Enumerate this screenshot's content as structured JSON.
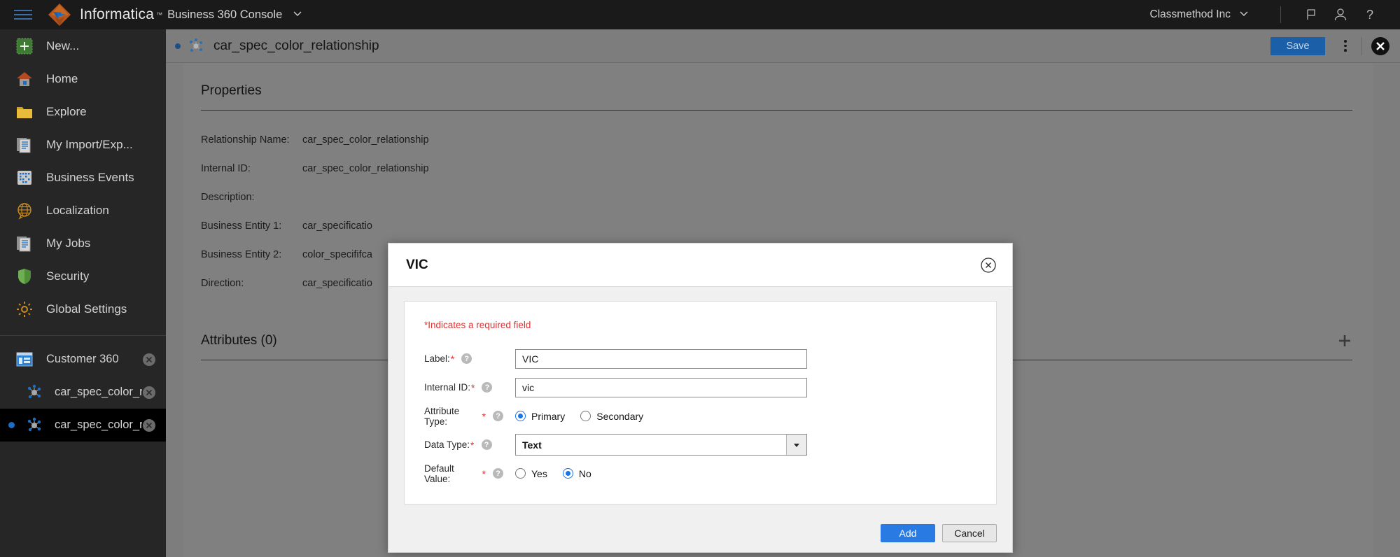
{
  "topbar": {
    "menu_icon": "hamburger-icon",
    "brand": "Informatica",
    "brand_mark": "™",
    "product": "Business 360 Console",
    "product_caret": "chevron-down-icon",
    "org": "Classmethod Inc",
    "org_caret": "chevron-down-icon",
    "flag_icon": "flag-icon",
    "user_icon": "user-icon",
    "help_icon": "help-icon"
  },
  "sidebar": {
    "items": [
      {
        "label": "New...",
        "icon": "plus-square-icon"
      },
      {
        "label": "Home",
        "icon": "home-icon"
      },
      {
        "label": "Explore",
        "icon": "folder-icon"
      },
      {
        "label": "My Import/Exp...",
        "icon": "documents-icon"
      },
      {
        "label": "Business Events",
        "icon": "grid-events-icon"
      },
      {
        "label": "Localization",
        "icon": "globe-icon"
      },
      {
        "label": "My Jobs",
        "icon": "documents-icon"
      },
      {
        "label": "Security",
        "icon": "shield-icon"
      },
      {
        "label": "Global Settings",
        "icon": "gear-icon"
      }
    ],
    "tabs": [
      {
        "label": "Customer 360",
        "icon": "app-window-icon",
        "active": false,
        "close_icon": "close-circle-icon"
      },
      {
        "label": "car_spec_color_r...",
        "icon": "relationship-icon",
        "active": false,
        "close_icon": "close-circle-icon"
      },
      {
        "label": "car_spec_color_r...",
        "icon": "relationship-icon",
        "active": true,
        "close_icon": "close-circle-icon"
      }
    ]
  },
  "document": {
    "title": "car_spec_color_relationship",
    "icon": "relationship-icon",
    "save_label": "Save",
    "kebab_icon": "more-vertical-icon",
    "close_icon": "close-circle-filled-icon"
  },
  "properties": {
    "section_title": "Properties",
    "rows": [
      {
        "key": "Relationship Name:",
        "value": "car_spec_color_relationship"
      },
      {
        "key": "Internal ID:",
        "value": "car_spec_color_relationship"
      },
      {
        "key": "Description:",
        "value": ""
      },
      {
        "key": "Business Entity 1:",
        "value": "car_specificatio"
      },
      {
        "key": "Business Entity 2:",
        "value": "color_specififca"
      },
      {
        "key": "Direction:",
        "value": "car_specificatio"
      }
    ]
  },
  "attributes": {
    "title": "Attributes (0)",
    "add_icon": "plus-icon"
  },
  "modal": {
    "title": "VIC",
    "close_icon": "close-circle-icon",
    "required_note_star": "*",
    "required_note": "Indicates a required field",
    "fields": [
      {
        "label": "Label:",
        "required": true,
        "help_icon": "help-circle-icon",
        "type": "text",
        "value": "VIC"
      },
      {
        "label": "Internal ID:",
        "required": true,
        "help_icon": "help-circle-icon",
        "type": "text",
        "value": "vic"
      },
      {
        "label": "Attribute Type:",
        "required": true,
        "help_icon": "help-circle-icon",
        "type": "radio",
        "options": [
          "Primary",
          "Secondary"
        ],
        "selected": "Primary"
      },
      {
        "label": "Data Type:",
        "required": true,
        "help_icon": "help-circle-icon",
        "type": "select",
        "value": "Text",
        "caret_icon": "caret-down-icon"
      },
      {
        "label": "Default Value:",
        "required": true,
        "help_icon": "help-circle-icon",
        "type": "radio",
        "options": [
          "Yes",
          "No"
        ],
        "selected": "No"
      }
    ],
    "add_label": "Add",
    "cancel_label": "Cancel"
  },
  "colors": {
    "accent_blue": "#2a7ae4",
    "save_blue": "#1b5fa8",
    "required_red": "#e03131",
    "topbar_bg": "#1a1a1a",
    "sidebar_bg": "#262626",
    "main_bg": "#7d7d7d"
  }
}
